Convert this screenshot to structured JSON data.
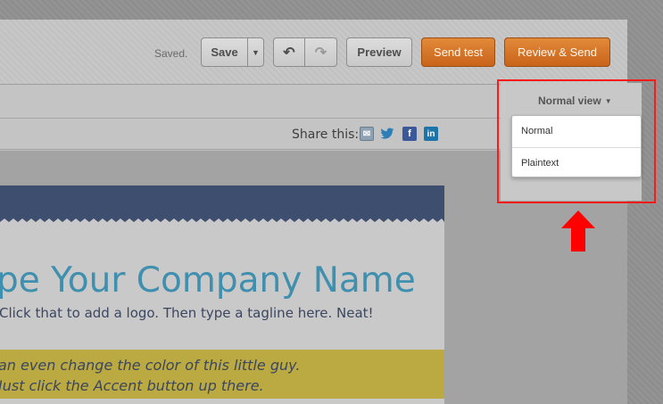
{
  "toolbar": {
    "status": "Saved.",
    "save_label": "Save",
    "save_menu_icon": "caret-down-icon",
    "undo_icon": "undo-icon",
    "redo_icon": "redo-icon",
    "preview_label": "Preview",
    "send_test_label": "Send test",
    "review_send_label": "Review & Send"
  },
  "view_selector": {
    "label": "Normal view",
    "options": [
      "Normal",
      "Plaintext"
    ]
  },
  "share": {
    "label": "Share this:",
    "icons": [
      "email-icon",
      "twitter-icon",
      "facebook-icon",
      "linkedin-icon"
    ],
    "fb_glyph": "f",
    "in_glyph": "in",
    "tw_glyph": "🐦",
    "mail_glyph": "✉"
  },
  "email": {
    "company_name": "pe Your Company Name",
    "tagline": "Click that to add a logo. Then type a tagline here. Neat!",
    "accent_line1": "an even change the color of this little guy.",
    "accent_line2": "Just click the Accent button up there."
  },
  "colors": {
    "header": "#3e4e6e",
    "accent": "#bba942",
    "title": "#3f8faf",
    "orange_button": "#d67428",
    "highlight": "#ff1a1a"
  }
}
